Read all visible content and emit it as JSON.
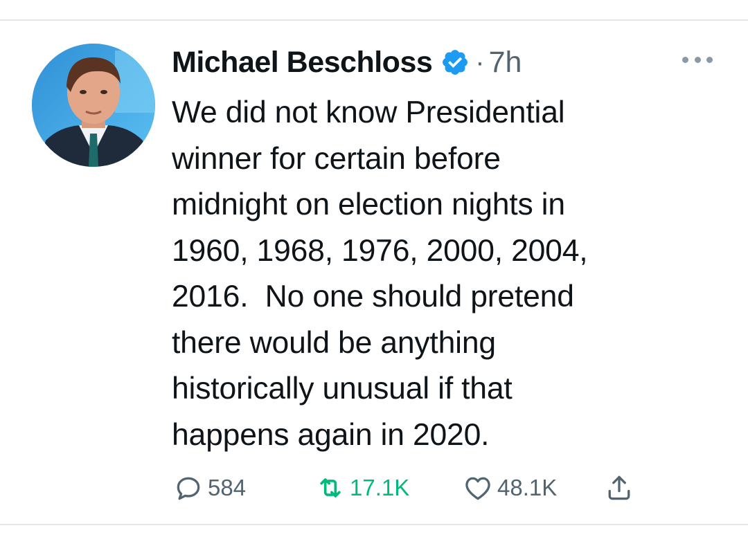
{
  "tweet": {
    "author": {
      "display_name": "Michael Beschloss",
      "verified": true,
      "avatar_icon": "profile-photo"
    },
    "separator": "·",
    "time": "7h",
    "text_lines": [
      "We did not know Presidential",
      "winner for certain before",
      "midnight on election nights in",
      "1960, 1968, 1976, 2000, 2004,",
      "2016.  No one should pretend",
      "there would be anything",
      "historically unusual if that",
      "happens again in 2020."
    ],
    "actions": {
      "reply": {
        "icon": "reply-icon",
        "count": "584"
      },
      "retweet": {
        "icon": "retweet-icon",
        "count": "17.1K"
      },
      "like": {
        "icon": "heart-icon",
        "count": "48.1K"
      },
      "share": {
        "icon": "share-icon"
      }
    },
    "more_icon": "more-horizontal-icon"
  },
  "colors": {
    "text": "#0f1419",
    "muted": "#536471",
    "verified": "#1d9bf0",
    "retweet_active": "#00ba7c",
    "divider": "#e6e6e6"
  }
}
